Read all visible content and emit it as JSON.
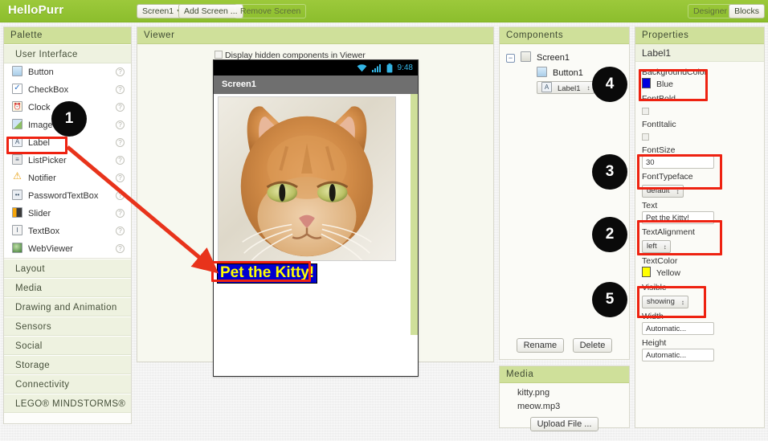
{
  "topbar": {
    "app_title": "HelloPurr",
    "screen_selector": "Screen1",
    "add_screen": "Add Screen ...",
    "remove_screen": "Remove Screen",
    "designer": "Designer",
    "blocks": "Blocks"
  },
  "palette": {
    "title": "Palette",
    "open_category": "User Interface",
    "components": [
      {
        "label": "Button",
        "icon": "button-icon",
        "glyph": ""
      },
      {
        "label": "CheckBox",
        "icon": "checkbox-icon",
        "glyph": "✓"
      },
      {
        "label": "Clock",
        "icon": "clock-icon",
        "glyph": "⏰"
      },
      {
        "label": "Image",
        "icon": "image-icon",
        "glyph": ""
      },
      {
        "label": "Label",
        "icon": "label-icon",
        "glyph": "A"
      },
      {
        "label": "ListPicker",
        "icon": "listpicker-icon",
        "glyph": "≡"
      },
      {
        "label": "Notifier",
        "icon": "notifier-icon",
        "glyph": "⚠"
      },
      {
        "label": "PasswordTextBox",
        "icon": "password-icon",
        "glyph": "••"
      },
      {
        "label": "Slider",
        "icon": "slider-icon",
        "glyph": ""
      },
      {
        "label": "TextBox",
        "icon": "textbox-icon",
        "glyph": "I"
      },
      {
        "label": "WebViewer",
        "icon": "webviewer-icon",
        "glyph": ""
      }
    ],
    "categories": [
      "Layout",
      "Media",
      "Drawing and Animation",
      "Sensors",
      "Social",
      "Storage",
      "Connectivity",
      "LEGO® MINDSTORMS®"
    ],
    "help_glyph": "?"
  },
  "viewer": {
    "title": "Viewer",
    "hidden_components_label": "Display hidden components in Viewer",
    "hidden_components_checked": false,
    "phone": {
      "status_time": "9:48",
      "screen_title": "Screen1",
      "label_text": "Pet the Kitty!",
      "label_bg_color": "#0000d0",
      "label_text_color": "#ffff00"
    }
  },
  "components_panel": {
    "title": "Components",
    "tree": [
      {
        "label": "Screen1",
        "icon": "screen-icon",
        "selected": false,
        "depth": 0
      },
      {
        "label": "Button1",
        "icon": "button-icon",
        "selected": false,
        "depth": 1
      },
      {
        "label": "Label1",
        "icon": "label-icon",
        "selected": true,
        "depth": 1
      }
    ],
    "expander_glyph": "−",
    "rename": "Rename",
    "delete": "Delete"
  },
  "media_panel": {
    "title": "Media",
    "files": [
      "kitty.png",
      "meow.mp3"
    ],
    "upload_button": "Upload File ..."
  },
  "properties": {
    "title": "Properties",
    "selected_component": "Label1",
    "items": [
      {
        "name": "BackgroundColor",
        "type": "color",
        "value": "Blue",
        "color": "#0000dd"
      },
      {
        "name": "FontBold",
        "type": "checkbox",
        "value": "",
        "checked": false
      },
      {
        "name": "FontItalic",
        "type": "checkbox",
        "value": "",
        "checked": false
      },
      {
        "name": "FontSize",
        "type": "text",
        "value": "30"
      },
      {
        "name": "FontTypeface",
        "type": "select",
        "value": "default"
      },
      {
        "name": "Text",
        "type": "text",
        "value": "Pet the Kitty!"
      },
      {
        "name": "TextAlignment",
        "type": "select",
        "value": "left"
      },
      {
        "name": "TextColor",
        "type": "color",
        "value": "Yellow",
        "color": "#ffff00"
      },
      {
        "name": "Visible",
        "type": "select",
        "value": "showing"
      },
      {
        "name": "Width",
        "type": "text",
        "value": "Automatic..."
      },
      {
        "name": "Height",
        "type": "text",
        "value": "Automatic..."
      }
    ]
  },
  "annotations": {
    "accent_color": "#ee2211",
    "markers": [
      {
        "number": "1",
        "target": "palette-label-item"
      },
      {
        "number": "2",
        "target": "property-text"
      },
      {
        "number": "3",
        "target": "property-fontsize"
      },
      {
        "number": "4",
        "target": "property-backgroundcolor"
      },
      {
        "number": "5",
        "target": "property-textcolor"
      }
    ]
  }
}
